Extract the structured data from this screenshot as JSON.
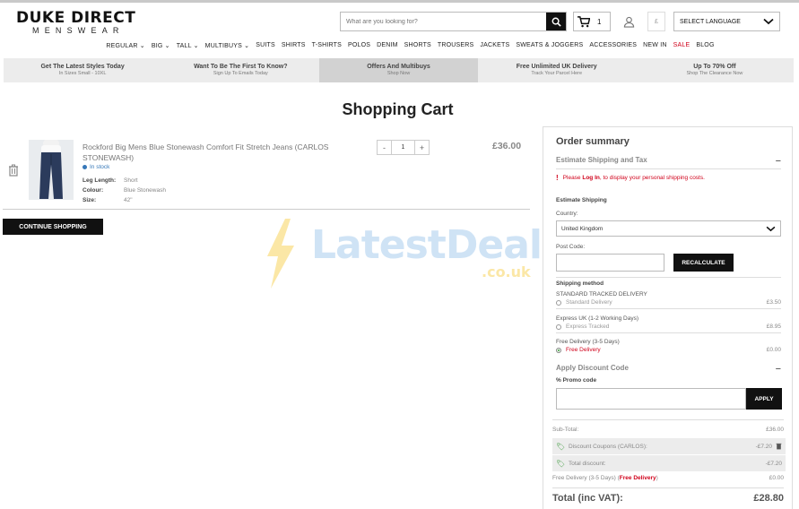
{
  "header": {
    "logo_main": "DUKE DIRECT",
    "logo_sub": "MENSWEAR",
    "search_placeholder": "What are you looking for?",
    "cart_count": "1",
    "currency": "£",
    "language_label": "SELECT LANGUAGE"
  },
  "nav": {
    "items": [
      "REGULAR ⌄",
      "BIG ⌄",
      "TALL ⌄",
      "MULTIBUYS ⌄",
      "SUITS",
      "SHIRTS",
      "T-SHIRTS",
      "POLOS",
      "DENIM",
      "SHORTS",
      "TROUSERS",
      "JACKETS",
      "SWEATS & JOGGERS",
      "ACCESSORIES",
      "NEW IN",
      "SALE",
      "BLOG"
    ]
  },
  "promos": [
    {
      "title": "Get The Latest Styles Today",
      "sub": "In Sizes Small - 10XL"
    },
    {
      "title": "Want To Be The First To Know?",
      "sub": "Sign Up To Emails Today"
    },
    {
      "title": "Offers And Multibuys",
      "sub": "Shop Now"
    },
    {
      "title": "Free Unlimited UK Delivery",
      "sub": "Track Your Parcel Here"
    },
    {
      "title": "Up To 70% Off",
      "sub": "Shop The Clearance Now"
    }
  ],
  "page_title": "Shopping Cart",
  "watermark": {
    "text": "LatestDeals",
    "suffix": ".co.uk"
  },
  "cart_item": {
    "name": "Rockford Big Mens Blue Stonewash Comfort Fit Stretch Jeans (CARLOS STONEWASH)",
    "stock": "In stock",
    "attrs": [
      {
        "k": "Leg Length:",
        "v": "Short"
      },
      {
        "k": "Colour:",
        "v": "Blue Stonewash"
      },
      {
        "k": "Size:",
        "v": "42\""
      }
    ],
    "qty_minus": "-",
    "qty": "1",
    "qty_plus": "+",
    "price": "£36.00"
  },
  "continue_label": "CONTINUE SHOPPING",
  "summary": {
    "title": "Order summary",
    "estimate_title": "Estimate Shipping and Tax",
    "notice_pre": "Please",
    "notice_link": "Log In",
    "notice_post": ", to display your personal shipping costs.",
    "estimate_shipping": "Estimate Shipping",
    "country_label": "Country:",
    "country_value": "United Kingdom",
    "postcode_label": "Post Code:",
    "recalc_label": "RECALCULATE",
    "method_title": "Shipping method",
    "methods": [
      {
        "name": "STANDARD TRACKED DELIVERY",
        "option": "Standard Delivery",
        "price": "£3.50",
        "selected": false
      },
      {
        "name": "Express UK (1-2 Working Days)",
        "option": "Express Tracked",
        "price": "£8.95",
        "selected": false
      },
      {
        "name": "Free Delivery (3-5 Days)",
        "option": "Free Delivery",
        "price": "£0.00",
        "selected": true
      }
    ],
    "discount_title": "Apply Discount Code",
    "promo_label": "% Promo code",
    "apply_label": "APPLY",
    "subtotal_label": "Sub-Total:",
    "subtotal": "£36.00",
    "coupon_label": "Discount Coupons (CARLOS):",
    "coupon_value": "-£7.20",
    "total_discount_label": "Total discount:",
    "total_discount": "-£7.20",
    "delivery_label": "Free Delivery (3-5 Days)",
    "delivery_name": "Free Delivery",
    "delivery_value": "£0.00",
    "total_label": "Total (inc VAT):",
    "total": "£28.80"
  },
  "colors": {
    "accent_red": "#d0021b",
    "dark": "#111111",
    "instock_blue": "#3778b8",
    "green": "#3a9a3a"
  }
}
